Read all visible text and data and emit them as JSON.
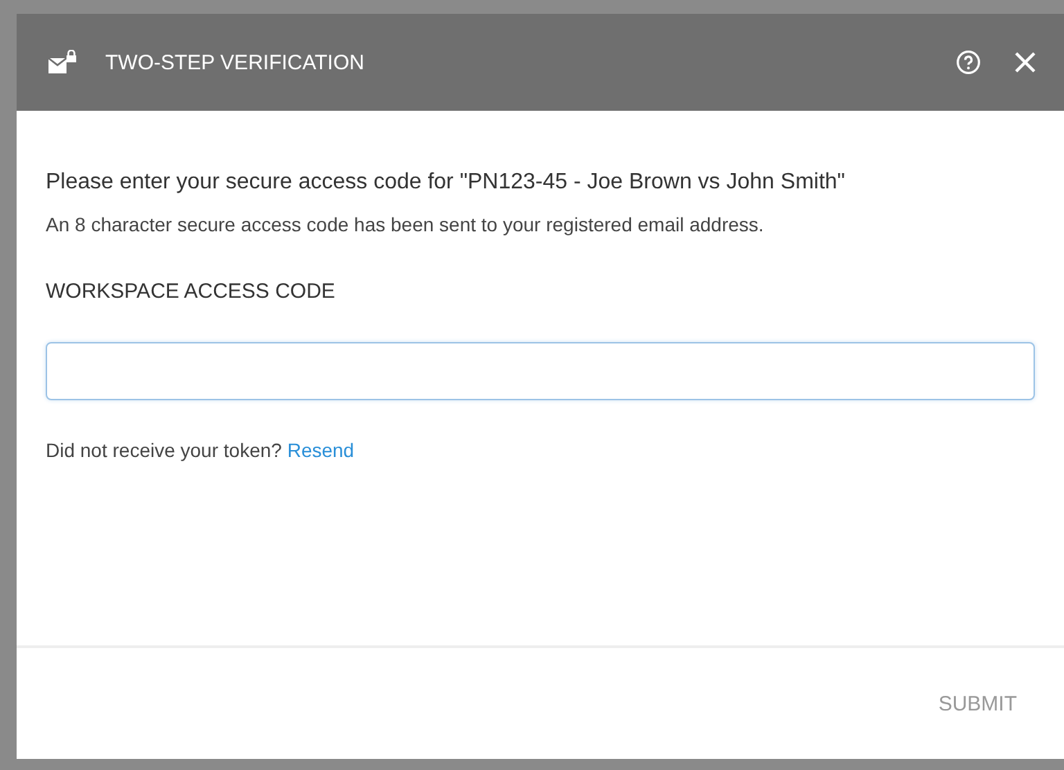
{
  "dialog": {
    "title": "TWO-STEP VERIFICATION"
  },
  "prompt": "Please enter your secure access code for \"PN123-45 - Joe Brown vs John Smith\"",
  "info": "An 8 character secure access code has been sent to your registered email address.",
  "field": {
    "label": "WORKSPACE ACCESS CODE"
  },
  "resend": {
    "text": "Did not receive your token?",
    "link": "Resend"
  },
  "submit": {
    "label": "SUBMIT",
    "disabled": true
  }
}
